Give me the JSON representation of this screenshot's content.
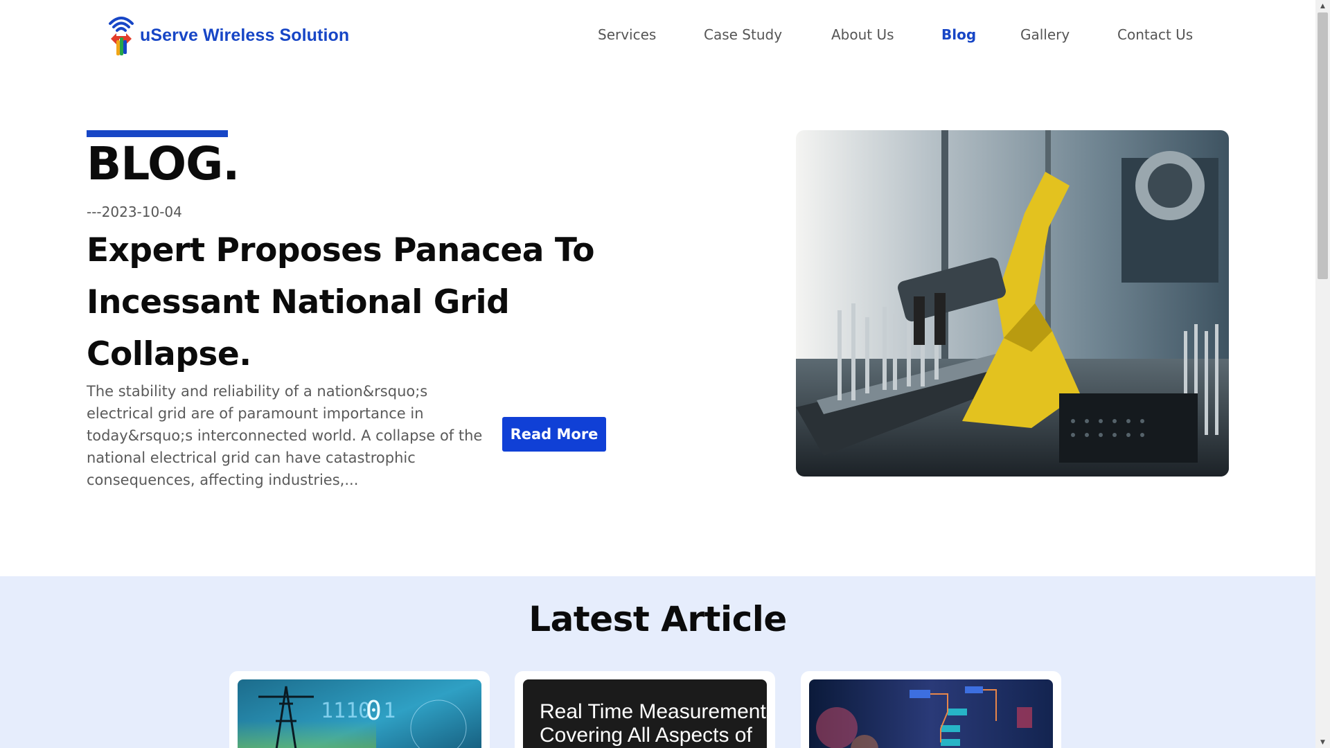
{
  "header": {
    "brand": "uServe Wireless Solution",
    "nav": [
      {
        "label": "Services",
        "active": false
      },
      {
        "label": "Case Study",
        "active": false
      },
      {
        "label": "About Us",
        "active": false
      },
      {
        "label": "Blog",
        "active": true
      },
      {
        "label": "Gallery",
        "active": false
      },
      {
        "label": "Contact Us",
        "active": false
      }
    ]
  },
  "hero": {
    "heading": "BLOG.",
    "date": "---2023-10-04",
    "title": "Expert Proposes Panacea To Incessant National Grid Collapse.",
    "excerpt": "The stability and reliability of a nation&rsquo;s electrical grid are of paramount importance in today&rsquo;s interconnected world. A collapse of the national electrical grid can have catastrophic consequences, affecting industries,...",
    "read_more": "Read More"
  },
  "latest": {
    "title": "Latest Article",
    "cards": [
      {
        "overlay": ""
      },
      {
        "overlay": "Real Time Measurements\nCovering All Aspects of"
      },
      {
        "overlay": ""
      }
    ]
  },
  "colors": {
    "brand_blue": "#1746c6",
    "button_blue": "#1040d6",
    "section_bg": "#e6edfc"
  }
}
